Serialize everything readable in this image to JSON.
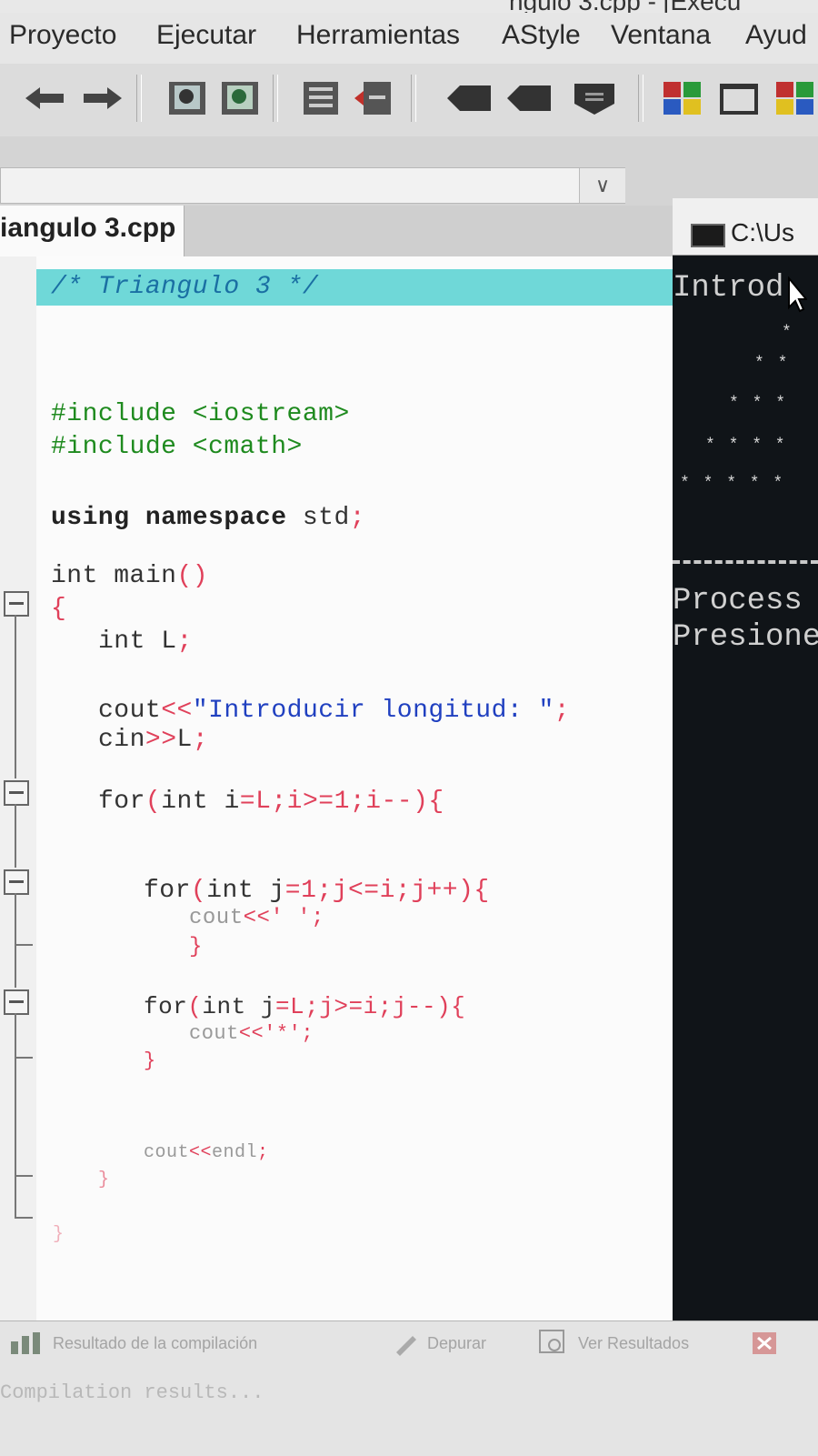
{
  "window": {
    "title_fragment": "ngulo 3.cpp - [Execu"
  },
  "menu": {
    "items": [
      "Proyecto",
      "Ejecutar",
      "Herramientas",
      "AStyle",
      "Ventana",
      "Ayud"
    ]
  },
  "editor": {
    "tab_label": "iangulo 3.cpp",
    "colors": {
      "highlight": "#6fd8d8",
      "preprocessor": "#1e8a1e",
      "symbol": "#e0405a",
      "string": "#2040c0"
    },
    "lines": {
      "l1": "/* Triangulo 3 */",
      "l2": "#include <iostream>",
      "l3": "#include <cmath>",
      "l4_kw": "using namespace",
      "l4_id": " std",
      "l4_sym": ";",
      "l5_type": "int",
      "l5_id": " main",
      "l5_sym": "()",
      "l6": "{",
      "l7_type": "int",
      "l7_id": " L",
      "l7_sym": ";",
      "l8_id": "cout",
      "l8_sym": "<<",
      "l8_str": "\"Introducir longitud: \"",
      "l8_end": ";",
      "l9_id": "cin",
      "l9_sym": ">>",
      "l9_id2": "L",
      "l9_end": ";",
      "l10_a": "for",
      "l10_b": "(",
      "l10_c": "int",
      "l10_d": " i",
      "l10_e": "=L;i>=1;i--){",
      "l11_a": "for",
      "l11_b": "(",
      "l11_c": "int",
      "l11_d": " j",
      "l11_e": "=1;j<=i;j++){",
      "l12_a": "cout",
      "l12_b": "<<' ';",
      "l13": "}",
      "l14_a": "for",
      "l14_b": "(",
      "l14_c": "int",
      "l14_d": " j",
      "l14_e": "=L;j>=i;j--){",
      "l15_a": "cout",
      "l15_b": "<<'*';",
      "l16": "}",
      "l17_a": "cout",
      "l17_b": "<<",
      "l17_c": "endl",
      "l17_d": ";",
      "l18": "}",
      "l19": "}"
    }
  },
  "console": {
    "title": "C:\\Us",
    "line_intro": "Introd",
    "stars": [
      "*",
      "* *",
      "* * *",
      "* * * *",
      "* * * * *"
    ],
    "line_process": "Process",
    "line_presione": "Presione"
  },
  "bottom_panel": {
    "tabs": [
      "Resultado de la compilación",
      "Depurar",
      "Ver Resultados"
    ],
    "log": "Compilation results..."
  }
}
